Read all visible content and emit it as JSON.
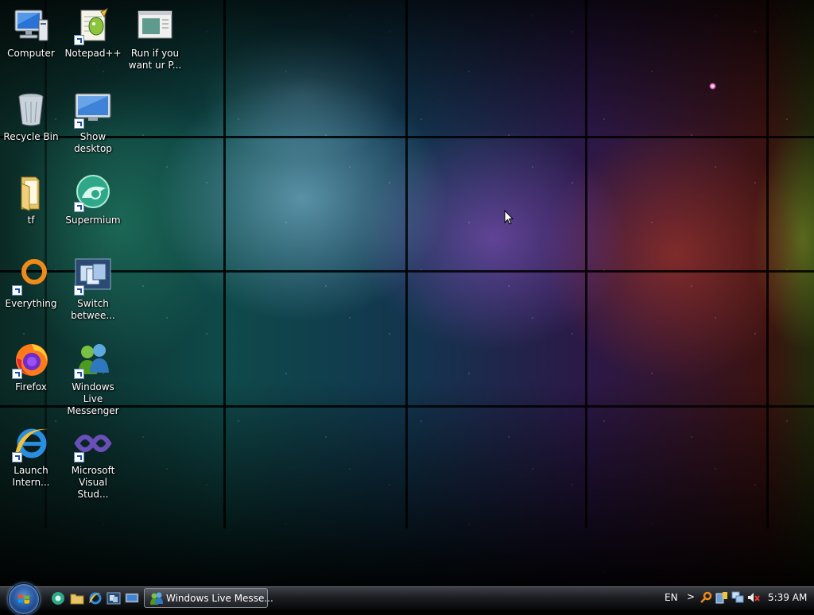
{
  "desktop": {
    "icons": [
      {
        "label": "Computer"
      },
      {
        "label": "Notepad++"
      },
      {
        "label": "Run if you want ur P..."
      },
      {
        "label": "Recycle Bin"
      },
      {
        "label": "Show desktop"
      },
      {
        "label": "tf"
      },
      {
        "label": "Supermium"
      },
      {
        "label": "Everything"
      },
      {
        "label": "Switch betwee..."
      },
      {
        "label": "Firefox"
      },
      {
        "label": "Windows Live Messenger"
      },
      {
        "label": "Launch Intern..."
      },
      {
        "label": "Microsoft Visual Stud..."
      }
    ]
  },
  "taskbar": {
    "start_button": "start-orb",
    "quick_launch": [
      "chrome-icon",
      "folder-icon",
      "internet-explorer-icon",
      "switch-windows-icon",
      "show-desktop-icon"
    ],
    "tasks": [
      {
        "label": "Windows Live Messe...",
        "icon": "messenger-icon"
      }
    ],
    "tray": {
      "language": "EN",
      "chevron": ">",
      "icons": [
        "search-icon",
        "network-status-icon",
        "network-icon",
        "volume-muted-icon"
      ],
      "clock": "5:39 AM"
    }
  }
}
